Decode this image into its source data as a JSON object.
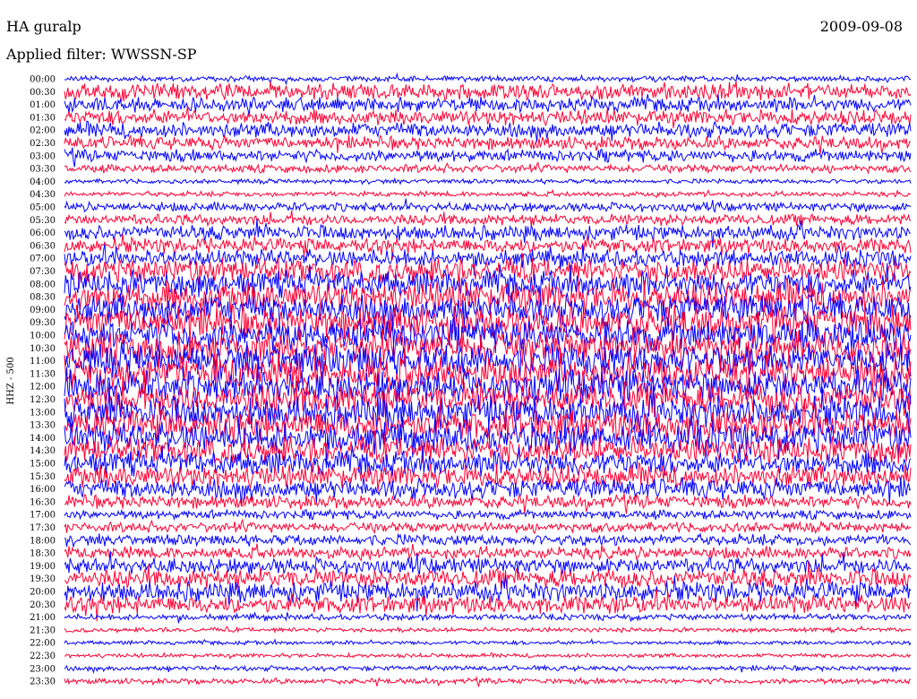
{
  "header": {
    "station": "HA guralp",
    "date": "2009-09-08",
    "filter_line": "Applied filter: WWSSN-SP"
  },
  "chart_data": {
    "type": "line",
    "title": "HA guralp",
    "ylabel": "HHZ - 500",
    "row_labels": [
      "00:00",
      "00:30",
      "01:00",
      "01:30",
      "02:00",
      "02:30",
      "03:00",
      "03:30",
      "04:00",
      "04:30",
      "05:00",
      "05:30",
      "06:00",
      "06:30",
      "07:00",
      "07:30",
      "08:00",
      "08:30",
      "09:00",
      "09:30",
      "10:00",
      "10:30",
      "11:00",
      "11:30",
      "12:00",
      "12:30",
      "13:00",
      "13:30",
      "14:00",
      "14:30",
      "15:00",
      "15:30",
      "16:00",
      "16:30",
      "17:00",
      "17:30",
      "18:00",
      "18:30",
      "19:00",
      "19:30",
      "20:00",
      "20:30",
      "21:00",
      "21:30",
      "22:00",
      "22:30",
      "23:00",
      "23:30"
    ],
    "trace_colors": [
      "#0000ff",
      "#ff0033"
    ],
    "relative_amplitude": [
      0.55,
      1.6,
      1.4,
      1.5,
      1.5,
      1.3,
      1.2,
      0.8,
      0.45,
      0.5,
      0.9,
      1.1,
      1.5,
      1.5,
      1.7,
      2.4,
      2.6,
      3.0,
      3.0,
      3.2,
      3.2,
      3.3,
      3.3,
      3.4,
      3.3,
      3.2,
      3.2,
      3.1,
      3.0,
      2.6,
      2.4,
      2.2,
      2.0,
      1.3,
      0.9,
      1.0,
      1.1,
      1.2,
      1.6,
      1.9,
      2.0,
      1.8,
      0.6,
      0.45,
      0.4,
      0.4,
      0.5,
      0.55
    ]
  }
}
